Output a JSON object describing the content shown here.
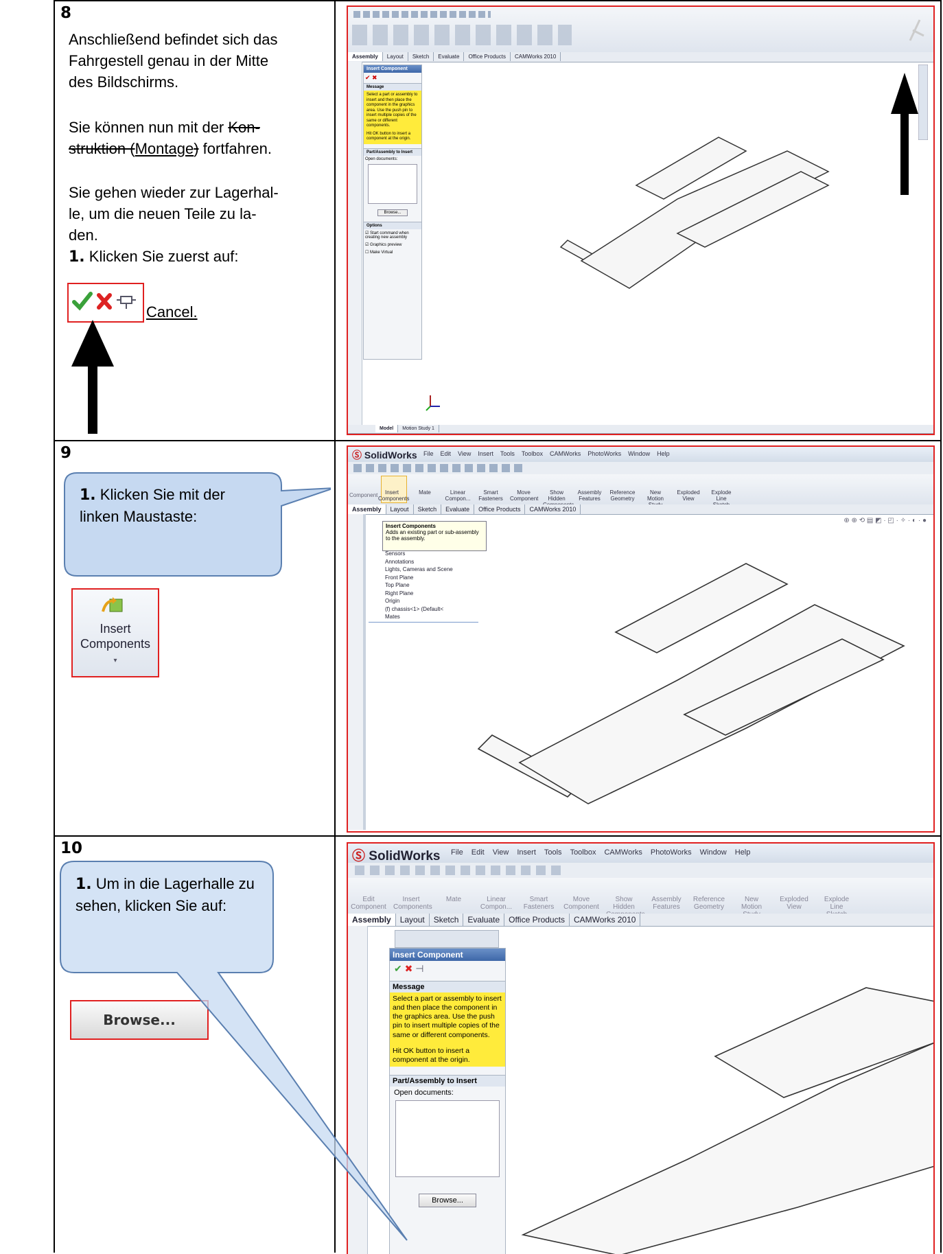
{
  "rows": [
    {
      "number": "8",
      "text": {
        "line1": "Anschließend befindet sich das",
        "line2": "Fahrgestell genau in der Mitte",
        "line3": "des Bildschirms.",
        "p2a": "Sie können nun mit der ",
        "p2b": "Kon-",
        "p2c": "struktion (",
        "p2d": "Montage",
        "p2e": ")",
        "p2f": " fortfahren.",
        "p3a": "Sie gehen wieder zur Lagerhal-",
        "p3b": "le, um die neuen Teile zu la-",
        "p3c": "den.",
        "step_num": "1.",
        "step_text": " Klicken Sie zuerst auf:",
        "cancel_label": "Cancel."
      },
      "screenshot": {
        "tabs": [
          "Assembly",
          "Layout",
          "Sketch",
          "Evaluate",
          "Office Products",
          "CAMWorks 2010"
        ],
        "pm_title": "Insert Component",
        "message_head": "Message",
        "message": "Select a part or assembly to insert and then place the component in the graphics area. Use the push pin to insert multiple copies of the same or different components.",
        "message2": "Hit OK button to insert a component at the origin.",
        "part_head": "Part/Assembly to Insert",
        "open_docs": "Open documents:",
        "browse": "Browse...",
        "options_head": "Options",
        "opt1": "Start command when creating new assembly",
        "opt2": "Graphics preview",
        "opt3": "Make Virtual",
        "bottom_tabs": [
          "Model",
          "Motion Study 1"
        ]
      }
    },
    {
      "number": "9",
      "callout_num": "1.",
      "callout_text": " Klicken Sie mit der linken Maustaste:",
      "button_label": "Insert Components",
      "screenshot": {
        "app": "SolidWorks",
        "menus": [
          "File",
          "Edit",
          "View",
          "Insert",
          "Tools",
          "Toolbox",
          "CAMWorks",
          "PhotoWorks",
          "Window",
          "Help"
        ],
        "ribbon": [
          "Insert Components",
          "Mate",
          "Linear Compon...",
          "Smart Fasteners",
          "Move Component",
          "Show Hidden Components",
          "Assembly Features",
          "Reference Geometry",
          "New Motion Study",
          "Exploded View",
          "Explode Line Sketch"
        ],
        "edit_component": "Component",
        "tabs": [
          "Assembly",
          "Layout",
          "Sketch",
          "Evaluate",
          "Office Products",
          "CAMWorks 2010"
        ],
        "tooltip_title": "Insert Components",
        "tooltip_text": "Adds an existing part or sub-assembly to the assembly.",
        "tree": [
          "Sensors",
          "Annotations",
          "Lights, Cameras and Scene",
          "Front Plane",
          "Top Plane",
          "Right Plane",
          "Origin",
          "(f) chassis<1> (Default<",
          "Mates"
        ]
      }
    },
    {
      "number": "10",
      "callout_num": "1.",
      "callout_text": " Um in die Lagerhalle zu sehen, klicken Sie auf:",
      "button_label": "Browse...",
      "screenshot": {
        "app": "SolidWorks",
        "menus": [
          "File",
          "Edit",
          "View",
          "Insert",
          "Tools",
          "Toolbox",
          "CAMWorks",
          "PhotoWorks",
          "Window",
          "Help"
        ],
        "ribbon": [
          "Edit Component",
          "Insert Components",
          "Mate",
          "Linear Compon...",
          "Smart Fasteners",
          "Move Component",
          "Show Hidden Components",
          "Assembly Features",
          "Reference Geometry",
          "New Motion Study",
          "Exploded View",
          "Explode Line Sketch"
        ],
        "tabs": [
          "Assembly",
          "Layout",
          "Sketch",
          "Evaluate",
          "Office Products",
          "CAMWorks 2010"
        ],
        "pm_title": "Insert Component",
        "message_head": "Message",
        "message": "Select a part or assembly to insert and then place the component in the graphics area. Use the push pin to insert multiple copies of the same or different components.",
        "message2": "Hit OK button to insert a component at the origin.",
        "part_head": "Part/Assembly to Insert",
        "open_docs": "Open documents:",
        "browse": "Browse..."
      }
    }
  ],
  "colors": {
    "highlight_border": "#e02020",
    "callout_fill": "#c6d9f1",
    "callout_stroke": "#5a7fb0",
    "message_yellow": "#ffeb3b"
  }
}
